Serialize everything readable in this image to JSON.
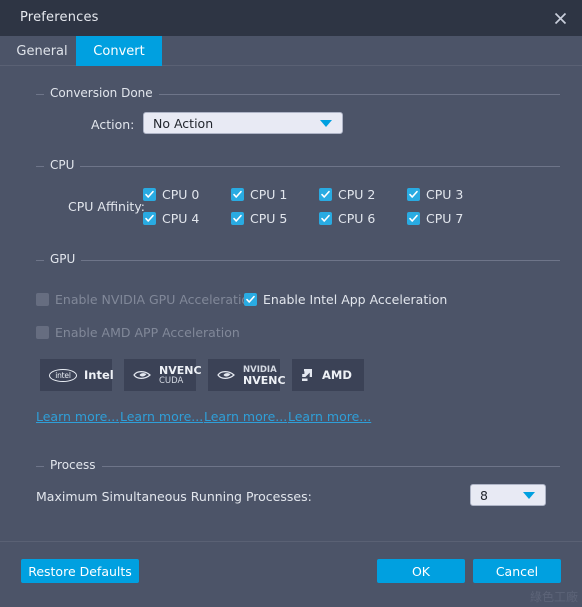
{
  "window": {
    "title": "Preferences",
    "close_icon": "close-icon"
  },
  "tabs": [
    {
      "label": "General",
      "selected": false
    },
    {
      "label": "Convert",
      "selected": true
    }
  ],
  "colors": {
    "accent": "#00a0e0",
    "checkbox_on": "#29abe2",
    "link": "#2f9fd8",
    "window_bg": "#4c5468",
    "titlebar_bg": "#2e3544",
    "badge_bg": "#3b4256"
  },
  "groups": {
    "conversion_done": {
      "title": "Conversion Done",
      "action_label": "Action:",
      "action_value": "No Action",
      "action_options": [
        "No Action"
      ]
    },
    "cpu": {
      "title": "CPU",
      "affinity_label": "CPU Affinity:",
      "checkboxes": [
        {
          "label": "CPU 0",
          "checked": true,
          "enabled": true
        },
        {
          "label": "CPU 1",
          "checked": true,
          "enabled": true
        },
        {
          "label": "CPU 2",
          "checked": true,
          "enabled": true
        },
        {
          "label": "CPU 3",
          "checked": true,
          "enabled": true
        },
        {
          "label": "CPU 4",
          "checked": true,
          "enabled": true
        },
        {
          "label": "CPU 5",
          "checked": true,
          "enabled": true
        },
        {
          "label": "CPU 6",
          "checked": true,
          "enabled": true
        },
        {
          "label": "CPU 7",
          "checked": true,
          "enabled": true
        }
      ]
    },
    "gpu": {
      "title": "GPU",
      "checkboxes": [
        {
          "label": "Enable NVIDIA GPU Acceleration",
          "checked": false,
          "enabled": false
        },
        {
          "label": "Enable Intel App Acceleration",
          "checked": true,
          "enabled": true
        },
        {
          "label": "Enable AMD APP Acceleration",
          "checked": false,
          "enabled": false
        }
      ],
      "badges": [
        {
          "logo": "intel-logo-icon",
          "logo_text": "intel",
          "line1": "Intel",
          "line2": ""
        },
        {
          "logo": "nvidia-eye-icon",
          "logo_text": "",
          "line1": "NVENC",
          "line2": "CUDA"
        },
        {
          "logo": "nvidia-eye-icon",
          "logo_text": "",
          "line1": "NVENC",
          "line2": "NVIDIA"
        },
        {
          "logo": "amd-arrow-icon",
          "logo_text": "",
          "line1": "AMD",
          "line2": ""
        }
      ],
      "links": [
        {
          "label": "Learn more..."
        },
        {
          "label": "Learn more..."
        },
        {
          "label": "Learn more..."
        },
        {
          "label": "Learn more..."
        }
      ]
    },
    "process": {
      "title": "Process",
      "max_processes_label": "Maximum Simultaneous Running Processes:",
      "max_processes_value": "8",
      "max_processes_options": [
        "8"
      ]
    }
  },
  "footer": {
    "restore_defaults": "Restore Defaults",
    "ok": "OK",
    "cancel": "Cancel"
  },
  "watermark": "綠色工廠"
}
